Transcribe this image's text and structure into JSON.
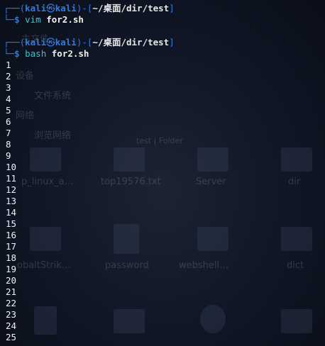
{
  "terminal": {
    "prompts": [
      {
        "user": "kali",
        "host": "kali",
        "path": "~/桌面/dir/test",
        "command": "vim",
        "arg": "for2.sh"
      },
      {
        "user": "kali",
        "host": "kali",
        "path": "~/桌面/dir/test",
        "command": "bash",
        "arg": "for2.sh"
      }
    ],
    "output": [
      "1",
      "2",
      "3",
      "4",
      "5",
      "6",
      "7",
      "8",
      "9",
      "10",
      "11",
      "12",
      "13",
      "14",
      "15",
      "16",
      "17",
      "18",
      "19",
      "20",
      "21",
      "22",
      "23",
      "24",
      "25"
    ]
  },
  "background": {
    "sidebar_labels": [
      "主文件",
      "设备",
      "文件系统",
      "网络",
      "浏览网络"
    ],
    "breadcrumb": "test | Folder",
    "file_labels": [
      "p_linux_a…",
      "top19576.txt",
      "Server",
      "dir",
      "obaltStrik…",
      "password",
      "webshell…",
      "dict"
    ]
  }
}
